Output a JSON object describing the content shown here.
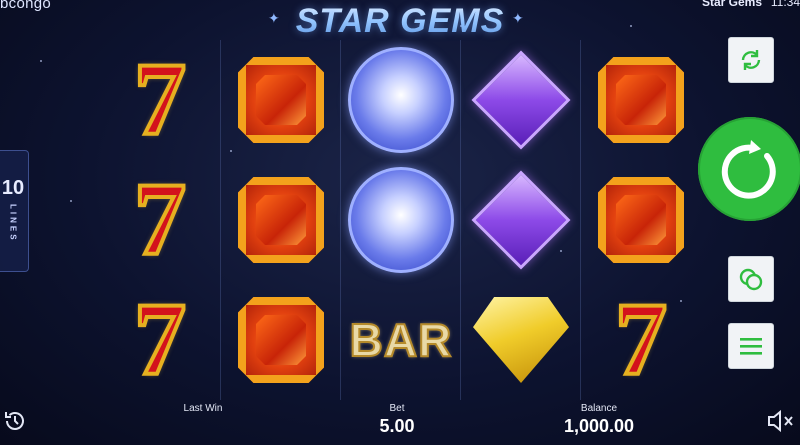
{
  "header": {
    "brand": "bcongo",
    "game_title": "Star Gems",
    "clock": "11:34",
    "logo": "STAR GEMS"
  },
  "lines_badge": {
    "count": "10",
    "label": "LINES"
  },
  "reels": [
    [
      "seven",
      "seven",
      "seven"
    ],
    [
      "ruby",
      "ruby",
      "ruby"
    ],
    [
      "sapphire",
      "sapphire",
      "bar"
    ],
    [
      "amethyst",
      "amethyst",
      "topaz"
    ],
    [
      "ruby",
      "ruby",
      "seven"
    ]
  ],
  "symbols": {
    "seven_glyph": "7",
    "bar_text": "BAR"
  },
  "controls": {
    "autoplay_icon": "refresh-icon",
    "spin_icon": "spin-icon",
    "coins_icon": "coins-icon",
    "menu_icon": "menu-icon",
    "accent_color": "#2fbd3f"
  },
  "footer": {
    "history_icon": "history-icon",
    "last_win_label": "Last Win",
    "last_win_value": "",
    "bet_label": "Bet",
    "bet_value": "5.00",
    "balance_label": "Balance",
    "balance_value": "1,000.00",
    "mute_icon": "speaker-mute-icon"
  }
}
